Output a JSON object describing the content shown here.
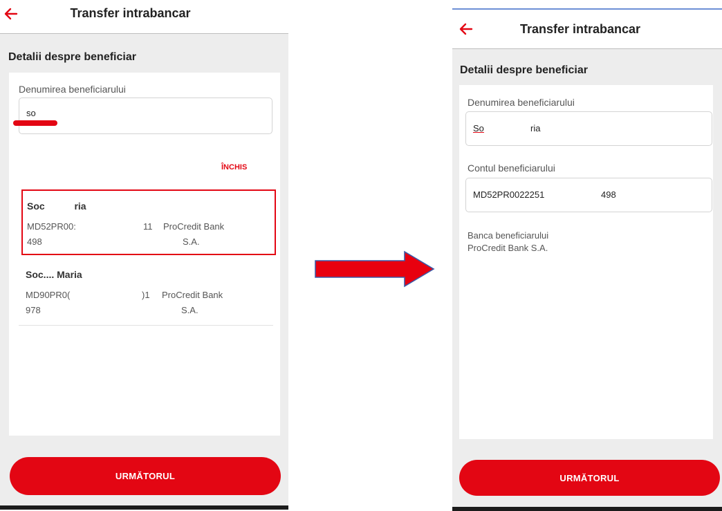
{
  "colors": {
    "brand_red": "#e30613",
    "screen_bg": "#ededed"
  },
  "left_screen": {
    "header": {
      "title": "Transfer intrabancar",
      "back_icon": "arrow-left-icon"
    },
    "section_title": "Detalii despre beneficiar",
    "search": {
      "label": "Denumirea beneficiarului",
      "value": "so"
    },
    "close_label": "ÎNCHIS",
    "results": [
      {
        "name": "Soc           ria",
        "iban": "MD52PR00:",
        "iban_mid": "11",
        "iban_tail": "498",
        "bank": "ProCredit Bank",
        "bank_tail": "S.A.",
        "selected": true
      },
      {
        "name": "Soc.... Maria",
        "iban": "MD90PR0(",
        "iban_mid": ")1",
        "iban_tail": "978",
        "bank": "ProCredit Bank",
        "bank_tail": "S.A.",
        "selected": false
      }
    ],
    "next_button": "URMĂTORUL"
  },
  "right_screen": {
    "header": {
      "title": "Transfer intrabancar",
      "back_icon": "arrow-left-icon"
    },
    "section_title": "Detalii despre beneficiar",
    "name_field": {
      "label": "Denumirea beneficiarului",
      "value_start": "So",
      "value_end": "ria"
    },
    "account_field": {
      "label": "Contul beneficiarului",
      "value_start": "MD52PR0022251",
      "value_end": "498"
    },
    "bank_info": {
      "label": "Banca beneficiarului",
      "value": "ProCredit Bank S.A."
    },
    "next_button": "URMĂTORUL"
  }
}
